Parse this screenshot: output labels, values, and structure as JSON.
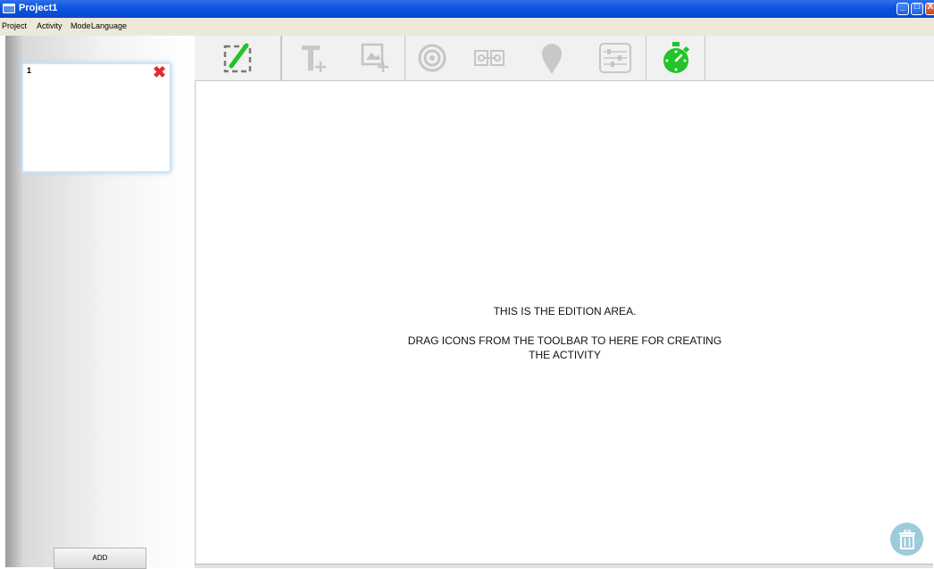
{
  "window": {
    "title": "Project1",
    "minimize_glyph": "_",
    "maximize_glyph": "□",
    "close_glyph": "X"
  },
  "menu": {
    "items": [
      "Project",
      "Activity",
      "Mode",
      "Language"
    ]
  },
  "slides": {
    "items": [
      {
        "number": "1",
        "delete_glyph": "✖"
      }
    ],
    "add_label": "ADD"
  },
  "toolbar": {
    "tools": [
      {
        "icon": "edit-frame-icon",
        "enabled": true
      },
      {
        "icon": "add-text-icon",
        "enabled": false
      },
      {
        "icon": "add-image-icon",
        "enabled": false
      },
      {
        "icon": "target-icon",
        "enabled": false
      },
      {
        "icon": "connector-icon",
        "enabled": false
      },
      {
        "icon": "map-pin-icon",
        "enabled": false
      },
      {
        "icon": "sliders-icon",
        "enabled": false
      },
      {
        "icon": "stopwatch-icon",
        "enabled": true
      }
    ]
  },
  "edition": {
    "line1": "THIS IS THE EDITION AREA.",
    "line2": "DRAG ICONS FROM THE TOOLBAR TO HERE FOR CREATING",
    "line3": "THE ACTIVITY"
  },
  "colors": {
    "title_bar": "#0b54e0",
    "accent_green": "#22c427",
    "delete_red": "#e32d2d",
    "trash_bg": "#9ccbdb"
  }
}
